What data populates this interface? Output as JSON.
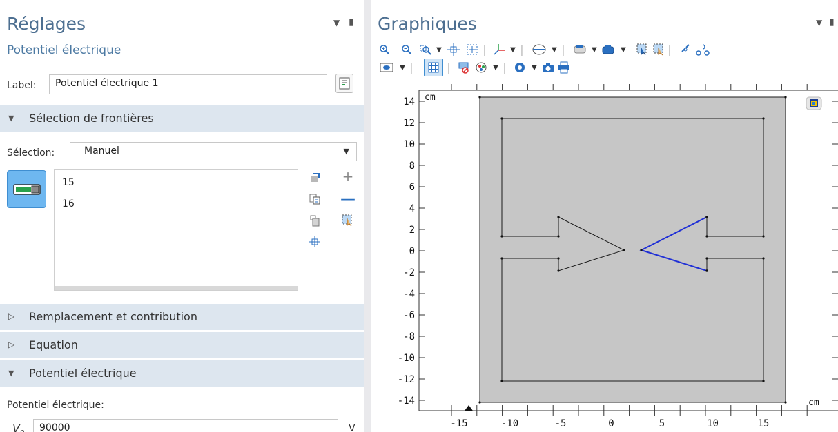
{
  "settings": {
    "title": "Réglages",
    "subtitle": "Potentiel électrique",
    "label_caption": "Label:",
    "label_value": "Potentiel électrique 1",
    "section_boundaries": "Sélection de frontières",
    "selection_caption": "Sélection:",
    "selection_value": "Manuel",
    "selected_items": [
      "15",
      "16"
    ],
    "section_override": "Remplacement et contribution",
    "section_equation": "Equation",
    "section_potential": "Potentiel électrique",
    "potential_caption": "Potentiel électrique:",
    "v0_symbol": "V",
    "v0_subscript": "0",
    "v0_value": "90000",
    "v0_unit": "V"
  },
  "graphics": {
    "title": "Graphiques",
    "unit_top": "cm",
    "unit_right": "cm",
    "y_ticks": [
      "14",
      "12",
      "10",
      "8",
      "6",
      "4",
      "2",
      "0",
      "-2",
      "-4",
      "-6",
      "-8",
      "-10",
      "-12",
      "-14"
    ],
    "x_ticks": [
      "-15",
      "-10",
      "-5",
      "0",
      "5",
      "10",
      "15"
    ],
    "colors": {
      "outer_fill": "#c6c6c6",
      "edge": "#1a1a1a",
      "selected_edge": "#1f2fd6",
      "accent": "#4d6f91"
    },
    "toolbar_icons": [
      "zoom-in-icon",
      "zoom-out-icon",
      "zoom-box-icon",
      "zoom-extents-icon",
      "center-icon",
      "axis-icon",
      "selection-icon",
      "transparency-icon",
      "light-icon",
      "select-box-icon",
      "select-all-icon",
      "link-icon",
      "view-icon",
      "grid-icon",
      "wireframe-icon",
      "render-icon",
      "camera-icon",
      "print-icon"
    ]
  }
}
